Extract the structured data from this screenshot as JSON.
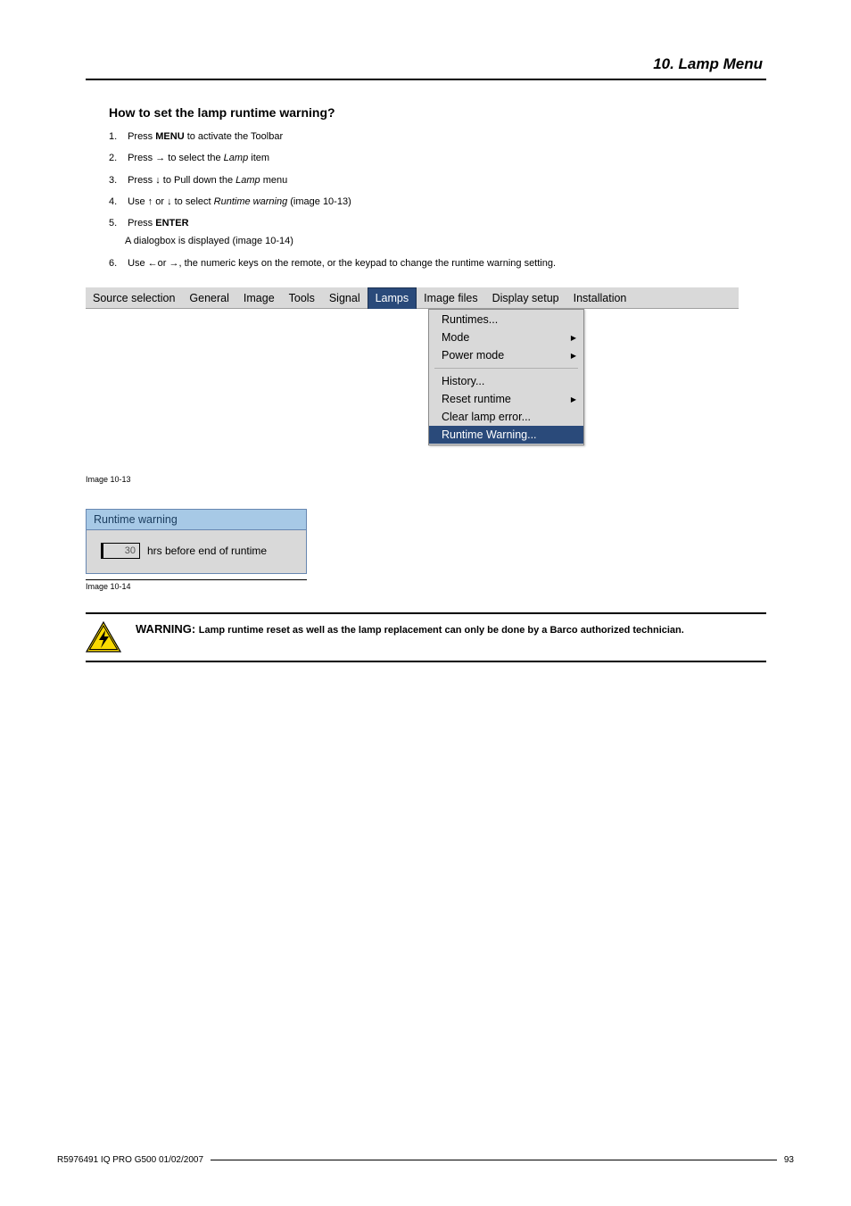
{
  "header": {
    "chapter": "10.  Lamp Menu"
  },
  "section_heading": "How to set the lamp runtime warning?",
  "steps": {
    "s1_num": "1.",
    "s1_a": "Press ",
    "s1_menu": "MENU",
    "s1_b": " to activate the Toolbar",
    "s2_num": "2.",
    "s2_a": "Press → to select the ",
    "s2_lamp": "Lamp",
    "s2_b": " item",
    "s3_num": "3.",
    "s3_a": "Press ↓ to Pull down the ",
    "s3_lamp": "Lamp",
    "s3_b": " menu",
    "s4_num": "4.",
    "s4_a": "Use ↑ or ↓ to select ",
    "s4_rw": "Runtime warning",
    "s4_b": " (image 10-13)",
    "s5_num": "5.",
    "s5_a": "Press ",
    "s5_enter": "ENTER",
    "s5_sub": "A dialogbox is displayed (image 10-14)",
    "s6_num": "6.",
    "s6_a": "Use ←or →, the numeric keys on the remote, or the keypad to change the runtime warning setting."
  },
  "menubar": {
    "items": [
      "Source selection",
      "General",
      "Image",
      "Tools",
      "Signal",
      "Lamps",
      "Image files",
      "Display setup",
      "Installation"
    ],
    "selected_index": 5
  },
  "dropdown": {
    "items": [
      {
        "label": "Runtimes...",
        "submenu": false,
        "selected": false
      },
      {
        "label": "Mode",
        "submenu": true,
        "selected": false
      },
      {
        "label": "Power mode",
        "submenu": true,
        "selected": false
      },
      {
        "label": "History...",
        "submenu": false,
        "selected": false
      },
      {
        "label": "Reset runtime",
        "submenu": true,
        "selected": false
      },
      {
        "label": "Clear lamp error...",
        "submenu": false,
        "selected": false
      },
      {
        "label": "Runtime Warning...",
        "submenu": false,
        "selected": true
      }
    ],
    "separator_after_index": 2
  },
  "caption_1013": "Image 10-13",
  "dialog": {
    "title": "Runtime warning",
    "value": "30",
    "label": "hrs before end of runtime"
  },
  "caption_1014": "Image 10-14",
  "warning": {
    "lead": "WARNING: ",
    "text": "Lamp runtime reset as well as the lamp replacement can only be done by a Barco authorized technician."
  },
  "footer": {
    "left": "R5976491  IQ PRO G500  01/02/2007",
    "right": "93"
  }
}
